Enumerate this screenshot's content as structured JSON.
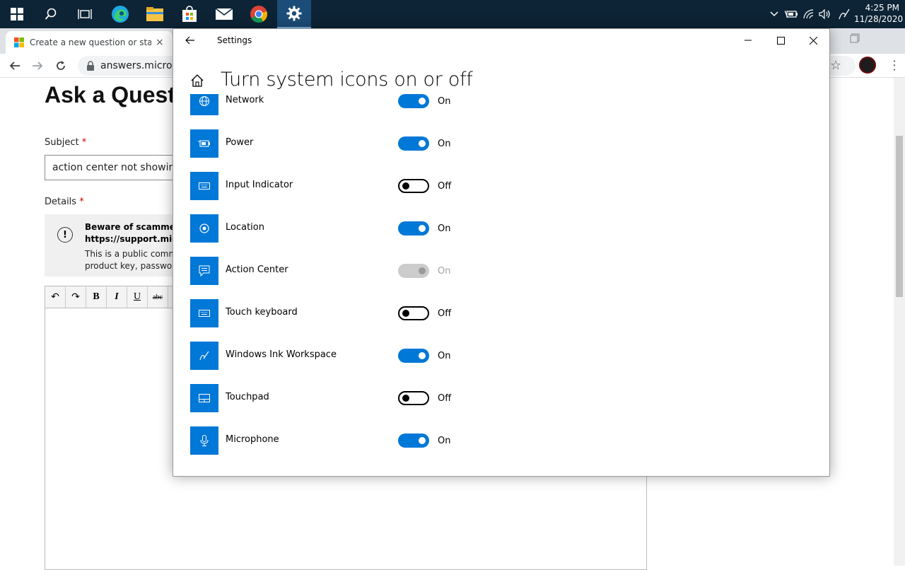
{
  "taskbar": {
    "clock_time": "4:25 PM",
    "clock_date": "11/28/2020",
    "apps": [
      "start-icon",
      "search-icon",
      "task-view-icon",
      "edge-icon",
      "file-explorer-icon",
      "store-icon",
      "mail-icon",
      "chrome-icon",
      "settings-icon"
    ],
    "tray": [
      "chevron-up-icon",
      "battery-icon",
      "wifi-icon",
      "volume-icon",
      "pen-icon"
    ]
  },
  "browser": {
    "tab_title": "Create a new question or start a",
    "tab_close": "×",
    "url": "answers.microsoft.com"
  },
  "webpage": {
    "heading": "Ask a Question",
    "subject_label": "Subject",
    "required_mark": "*",
    "subject_value": "action center not showing",
    "details_label": "Details",
    "warning_title_1": "Beware of scammers",
    "warning_title_2": "https://support.microsoft.com",
    "warning_body_1": "This is a public community",
    "warning_body_2": "product key, password",
    "editor_buttons": [
      "undo",
      "redo",
      "B",
      "I",
      "U",
      "abc"
    ]
  },
  "settings": {
    "window_title": "Settings",
    "page_title": "Turn system icons on or off",
    "items": [
      {
        "label": "Network",
        "icon": "globe-icon",
        "state": "On",
        "on": true,
        "disabled": false
      },
      {
        "label": "Power",
        "icon": "battery-icon",
        "state": "On",
        "on": true,
        "disabled": false
      },
      {
        "label": "Input Indicator",
        "icon": "keyboard-icon",
        "state": "Off",
        "on": false,
        "disabled": false
      },
      {
        "label": "Location",
        "icon": "location-icon",
        "state": "On",
        "on": true,
        "disabled": false
      },
      {
        "label": "Action Center",
        "icon": "action-center-icon",
        "state": "On",
        "on": true,
        "disabled": true
      },
      {
        "label": "Touch keyboard",
        "icon": "keyboard-icon",
        "state": "Off",
        "on": false,
        "disabled": false
      },
      {
        "label": "Windows Ink Workspace",
        "icon": "pen-icon",
        "state": "On",
        "on": true,
        "disabled": false
      },
      {
        "label": "Touchpad",
        "icon": "touchpad-icon",
        "state": "Off",
        "on": false,
        "disabled": false
      },
      {
        "label": "Microphone",
        "icon": "microphone-icon",
        "state": "On",
        "on": true,
        "disabled": false
      }
    ]
  },
  "colors": {
    "accent": "#0078d7",
    "taskbar": "#0d2436",
    "disabled": "#cccccc"
  }
}
